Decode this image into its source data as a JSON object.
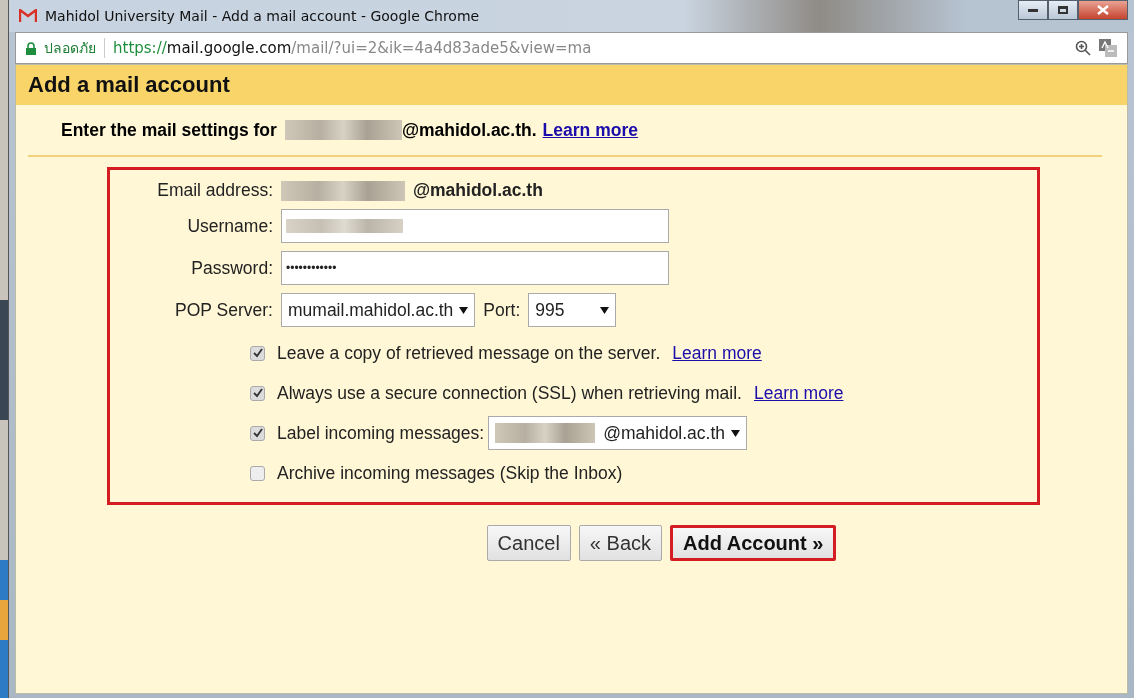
{
  "window": {
    "title": "Mahidol University Mail - Add a mail account - Google Chrome"
  },
  "address_bar": {
    "security_label": "ปลอดภัย",
    "scheme": "https://",
    "host": "mail.google.com",
    "path": "/mail/?ui=2&ik=4a4d83ade5&view=ma"
  },
  "dialog": {
    "title": "Add a mail account",
    "intro": "Enter the mail settings for",
    "intro_domain": "@mahidol.ac.th.",
    "intro_link": "Learn more"
  },
  "form": {
    "email_label": "Email address:",
    "email_domain": "@mahidol.ac.th",
    "username_label": "Username:",
    "password_label": "Password:",
    "password": "••••••••••••",
    "pop_label": "POP Server:",
    "pop_server": "mumail.mahidol.ac.th",
    "port_label": "Port:",
    "port": "995"
  },
  "options": [
    {
      "kind": "checkbox",
      "checked": true,
      "label": "Leave a copy of retrieved message on the server.",
      "link": "Learn more"
    },
    {
      "kind": "checkbox",
      "checked": true,
      "label": "Always use a secure connection (SSL) when retrieving mail.",
      "link": "Learn more"
    },
    {
      "kind": "select",
      "checked": true,
      "label": "Label incoming messages:",
      "value": "@mahidol.ac.th"
    },
    {
      "kind": "checkbox",
      "checked": false,
      "label": "Archive incoming messages (Skip the Inbox)"
    }
  ],
  "buttons": [
    {
      "label": "Cancel",
      "highlighted": false
    },
    {
      "label": "« Back",
      "highlighted": false
    },
    {
      "label": "Add Account »",
      "highlighted": true
    }
  ]
}
